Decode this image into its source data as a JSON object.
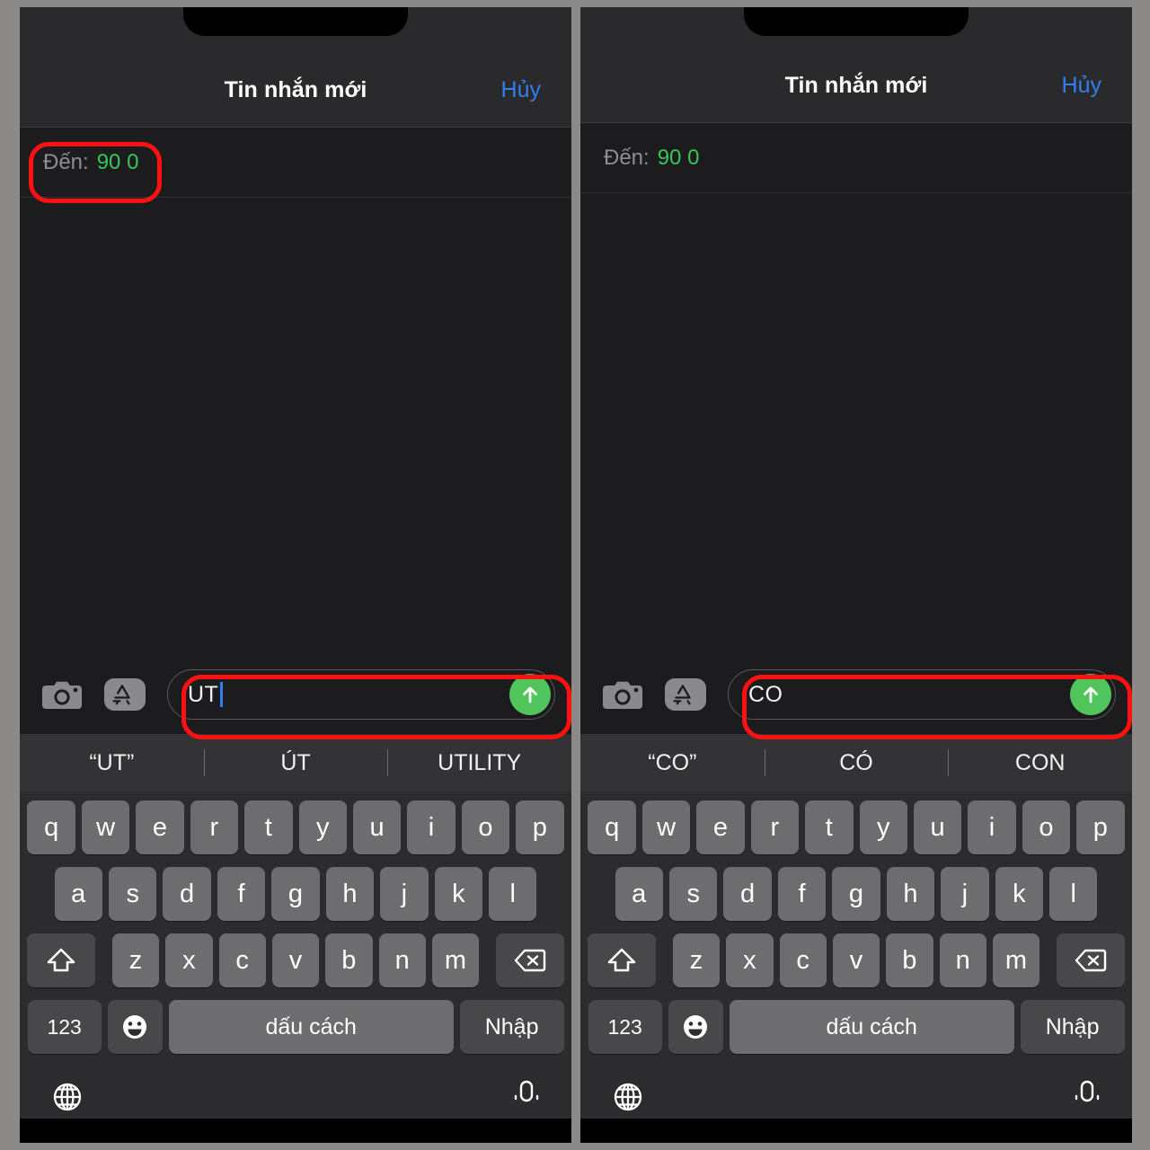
{
  "panels": [
    {
      "id": "left",
      "nav": {
        "title": "Tin nhắn mới",
        "cancel": "Hủy"
      },
      "recipient": {
        "label": "Đến:",
        "value": "90 0"
      },
      "composer": {
        "camera_icon": "camera-icon",
        "appstore_icon": "app-store-icon",
        "text": "UT",
        "send_icon": "send-arrow-up-icon"
      },
      "suggestions": [
        "“UT”",
        "ÚT",
        "UTILITY"
      ],
      "annotations": [
        "recipient-field-highlight",
        "message-input-highlight"
      ]
    },
    {
      "id": "right",
      "nav": {
        "title": "Tin nhắn mới",
        "cancel": "Hủy"
      },
      "recipient": {
        "label": "Đến:",
        "value": "90 0"
      },
      "composer": {
        "camera_icon": "camera-icon",
        "appstore_icon": "app-store-icon",
        "text": "CO",
        "send_icon": "send-arrow-up-icon"
      },
      "suggestions": [
        "“CO”",
        "CÓ",
        "CON"
      ],
      "annotations": [
        "message-input-highlight"
      ]
    }
  ],
  "keyboard": {
    "row1": [
      "q",
      "w",
      "e",
      "r",
      "t",
      "y",
      "u",
      "i",
      "o",
      "p"
    ],
    "row2": [
      "a",
      "s",
      "d",
      "f",
      "g",
      "h",
      "j",
      "k",
      "l"
    ],
    "row3": [
      "z",
      "x",
      "c",
      "v",
      "b",
      "n",
      "m"
    ],
    "shift_icon": "shift-up-arrow-icon",
    "delete_icon": "backspace-delete-icon",
    "numeric_label": "123",
    "emoji_icon": "emoji-smiley-icon",
    "space_label": "dấu cách",
    "return_label": "Nhập",
    "globe_icon": "globe-language-icon",
    "mic_icon": "microphone-dictation-icon"
  },
  "colors": {
    "accent_blue": "#2f7fef",
    "recipient_green": "#35c759",
    "send_green": "#52c45c",
    "annotation_red": "#ff1111",
    "keyboard_bg": "#2c2c2e",
    "key_light": "#6d6d70",
    "key_dark": "#48484a"
  }
}
